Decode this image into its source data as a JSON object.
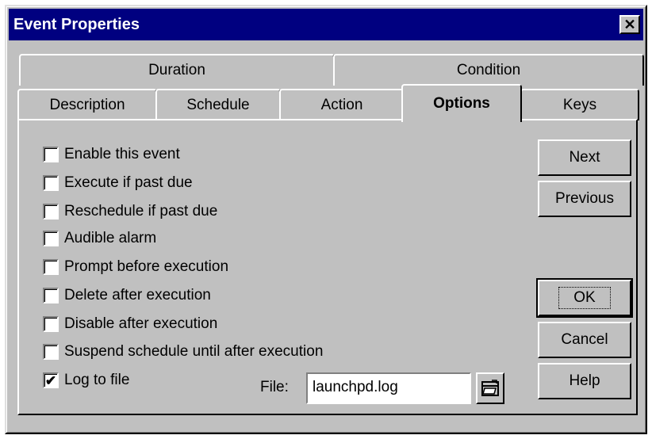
{
  "window": {
    "title": "Event Properties",
    "close_glyph": "✕"
  },
  "tabs": {
    "row1": [
      "Duration",
      "Condition"
    ],
    "row2": [
      "Description",
      "Schedule",
      "Action",
      "Options",
      "Keys"
    ],
    "active": "Options"
  },
  "options": [
    {
      "label": "Enable this event",
      "checked": false
    },
    {
      "label": "Execute if past due",
      "checked": false
    },
    {
      "label": "Reschedule if past due",
      "checked": false
    },
    {
      "label": "Audible alarm",
      "checked": false
    },
    {
      "label": "Prompt before execution",
      "checked": false
    },
    {
      "label": "Delete after execution",
      "checked": false
    },
    {
      "label": "Disable after execution",
      "checked": false
    },
    {
      "label": "Suspend schedule until after execution",
      "checked": false
    },
    {
      "label": "Log to file",
      "checked": true,
      "mark": "✔"
    }
  ],
  "file": {
    "label": "File:",
    "value": "launchpd.log"
  },
  "buttons": {
    "next": "Next",
    "previous": "Previous",
    "ok": "OK",
    "cancel": "Cancel",
    "help": "Help"
  },
  "icons": {
    "browse": "open-folder-icon"
  }
}
